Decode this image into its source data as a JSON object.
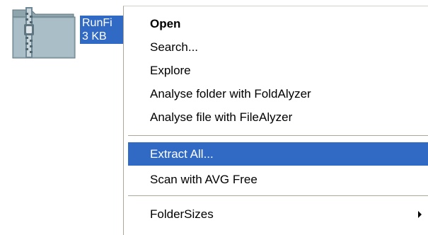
{
  "file": {
    "name": "RunFi",
    "size": "3 KB"
  },
  "context_menu": {
    "items": [
      {
        "label": "Open"
      },
      {
        "label": "Search..."
      },
      {
        "label": "Explore"
      },
      {
        "label": "Analyse folder with FoldAlyzer"
      },
      {
        "label": "Analyse file with FileAlyzer"
      },
      {
        "label": "Extract All..."
      },
      {
        "label": "Scan with AVG Free"
      },
      {
        "label": "FolderSizes"
      }
    ]
  },
  "colors": {
    "selection": "#316ac5",
    "separator": "#aca899",
    "icon": "zip-folder-icon"
  }
}
